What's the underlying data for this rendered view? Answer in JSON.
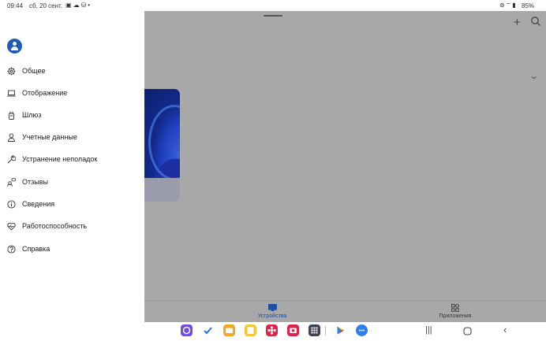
{
  "status_bar": {
    "time": "09:44",
    "date": "сб, 20 сент.",
    "battery": "85%",
    "left_icons": [
      "image-icon",
      "cloud-icon",
      "bag-icon",
      "dot-icon"
    ],
    "right_icons": [
      "hotspot-icon",
      "wifi-icon",
      "signal-icon"
    ]
  },
  "drawer": {
    "items": [
      {
        "icon": "gear-icon",
        "label": "Общее"
      },
      {
        "icon": "laptop-icon",
        "label": "Отображение"
      },
      {
        "icon": "gateway-icon",
        "label": "Шлюз"
      },
      {
        "icon": "person-icon",
        "label": "Учетные данные"
      },
      {
        "icon": "wrench-icon",
        "label": "Устранение неполадок"
      },
      {
        "icon": "feedback-icon",
        "label": "Отзывы"
      },
      {
        "icon": "info-icon",
        "label": "Сведения"
      },
      {
        "icon": "heart-pulse-icon",
        "label": "Работоспособность"
      },
      {
        "icon": "help-icon",
        "label": "Справка"
      }
    ]
  },
  "bottom_nav": {
    "devices_label": "Устройства",
    "apps_label": "Приложения",
    "active": "devices"
  },
  "colors": {
    "accent": "#1f5bb5",
    "overlay": "#a8a8a8"
  },
  "dock_apps": [
    {
      "icon": "purple-app-icon",
      "color": "#6f4ee0"
    },
    {
      "icon": "checkmark-app-icon",
      "color": "#ffffff"
    },
    {
      "icon": "folder-app-icon",
      "color": "#f5a623"
    },
    {
      "icon": "flower-app-icon",
      "color": "#e0224a"
    },
    {
      "icon": "camera-app-icon",
      "color": "#e0224a"
    },
    {
      "icon": "app-grid-icon",
      "color": "#3c4450"
    },
    {
      "icon": "play-store-icon",
      "color": "#ffffff"
    },
    {
      "icon": "messages-app-icon",
      "color": "#2f7ef0"
    }
  ]
}
